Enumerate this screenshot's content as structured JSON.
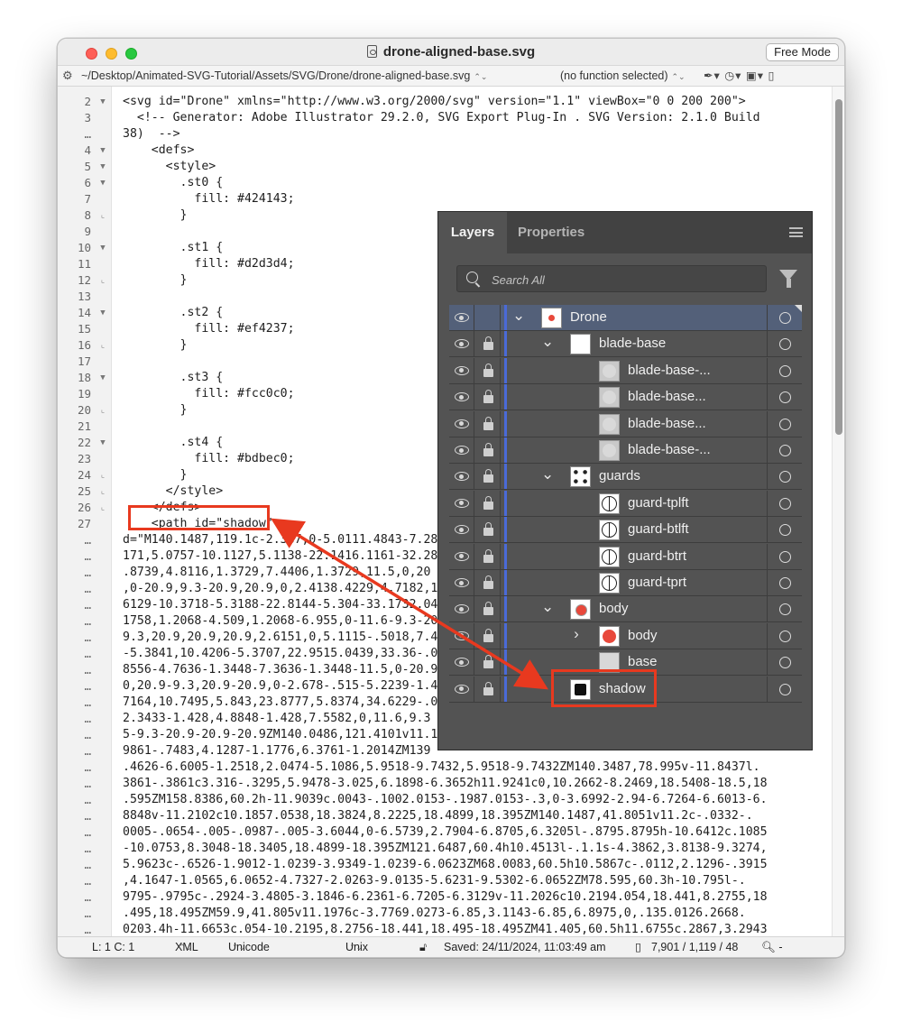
{
  "window": {
    "title": "drone-aligned-base.svg",
    "free_mode_button": "Free Mode"
  },
  "pathbar": {
    "path": "~/Desktop/Animated-SVG-Tutorial/Assets/SVG/Drone/drone-aligned-base.svg",
    "function_select": "(no function selected)"
  },
  "code": [
    {
      "ln": "2",
      "fold": "open",
      "cls": "tag",
      "text": "<svg id=\"Drone\" xmlns=\"http://www.w3.org/2000/svg\" version=\"1.1\" viewBox=\"0 0 200 200\">"
    },
    {
      "ln": "3",
      "fold": "",
      "cls": "cmt",
      "text": "  <!-- Generator: Adobe Illustrator 29.2.0, SVG Export Plug-In . SVG Version: 2.1.0 Build"
    },
    {
      "ln": "…",
      "fold": "",
      "cls": "cmt",
      "text": "38)  -->"
    },
    {
      "ln": "4",
      "fold": "open",
      "cls": "tag",
      "text": "    <defs>"
    },
    {
      "ln": "5",
      "fold": "open",
      "cls": "tag",
      "text": "      <style>"
    },
    {
      "ln": "6",
      "fold": "open",
      "cls": "",
      "text": "        .st0 {"
    },
    {
      "ln": "7",
      "fold": "",
      "cls": "",
      "text": "          fill: #424143;"
    },
    {
      "ln": "8",
      "fold": "close",
      "cls": "",
      "text": "        }"
    },
    {
      "ln": "9",
      "fold": "",
      "cls": "",
      "text": ""
    },
    {
      "ln": "10",
      "fold": "open",
      "cls": "",
      "text": "        .st1 {"
    },
    {
      "ln": "11",
      "fold": "",
      "cls": "",
      "text": "          fill: #d2d3d4;"
    },
    {
      "ln": "12",
      "fold": "close",
      "cls": "",
      "text": "        }"
    },
    {
      "ln": "13",
      "fold": "",
      "cls": "",
      "text": ""
    },
    {
      "ln": "14",
      "fold": "open",
      "cls": "",
      "text": "        .st2 {"
    },
    {
      "ln": "15",
      "fold": "",
      "cls": "",
      "text": "          fill: #ef4237;"
    },
    {
      "ln": "16",
      "fold": "close",
      "cls": "",
      "text": "        }"
    },
    {
      "ln": "17",
      "fold": "",
      "cls": "",
      "text": ""
    },
    {
      "ln": "18",
      "fold": "open",
      "cls": "",
      "text": "        .st3 {"
    },
    {
      "ln": "19",
      "fold": "",
      "cls": "",
      "text": "          fill: #fcc0c0;"
    },
    {
      "ln": "20",
      "fold": "close",
      "cls": "",
      "text": "        }"
    },
    {
      "ln": "21",
      "fold": "",
      "cls": "",
      "text": ""
    },
    {
      "ln": "22",
      "fold": "open",
      "cls": "",
      "text": "        .st4 {"
    },
    {
      "ln": "23",
      "fold": "",
      "cls": "",
      "text": "          fill: #bdbec0;"
    },
    {
      "ln": "24",
      "fold": "close",
      "cls": "",
      "text": "        }"
    },
    {
      "ln": "25",
      "fold": "close",
      "cls": "tag",
      "text": "      </style>"
    },
    {
      "ln": "26",
      "fold": "close",
      "cls": "tag",
      "text": "    </defs>"
    },
    {
      "ln": "27",
      "fold": "",
      "cls": "tag",
      "text": "    <path id=\"shadow\""
    },
    {
      "ln": "…",
      "fold": "",
      "cls": "dat",
      "text": "d=\"M140.1487,119.1c-2.387,0-5.0111.4843-7.2855,"
    },
    {
      "ln": "…",
      "fold": "",
      "cls": "dat",
      "text": "171,5.0757-10.1127,5.1138-22.1416.1161-32.28"
    },
    {
      "ln": "…",
      "fold": "",
      "cls": "dat",
      "text": ".8739,4.8116,1.3729,7.4406,1.3729,11.5,0,20"
    },
    {
      "ln": "…",
      "fold": "",
      "cls": "dat",
      "text": ",0-20.9,9.3-20.9,20.9,0,2.4138.4229,4.7182,1"
    },
    {
      "ln": "…",
      "fold": "",
      "cls": "dat",
      "text": "6129-10.3718-5.3188-22.8144-5.304-33.1732.04"
    },
    {
      "ln": "…",
      "fold": "",
      "cls": "dat",
      "text": "1758,1.2068-4.509,1.2068-6.955,0-11.6-9.3-20"
    },
    {
      "ln": "…",
      "fold": "",
      "cls": "dat",
      "text": "9.3,20.9,20.9,20.9,2.6151,0,5.1115-.5018,7.4"
    },
    {
      "ln": "…",
      "fold": "",
      "cls": "dat",
      "text": "-5.3841,10.4206-5.3707,22.9515.0439,33.36-.0"
    },
    {
      "ln": "…",
      "fold": "",
      "cls": "dat",
      "text": "8556-4.7636-1.3448-7.3636-1.3448-11.5,0-20.9"
    },
    {
      "ln": "…",
      "fold": "",
      "cls": "dat",
      "text": "0,20.9-9.3,20.9-20.9,0-2.678-.515-5.2239-1.4"
    },
    {
      "ln": "…",
      "fold": "",
      "cls": "dat",
      "text": "7164,10.7495,5.843,23.8777,5.8374,34.6229-.0"
    },
    {
      "ln": "…",
      "fold": "",
      "cls": "dat",
      "text": "2.3433-1.428,4.8848-1.428,7.5582,0,11.6,9.3"
    },
    {
      "ln": "…",
      "fold": "",
      "cls": "dat",
      "text": "5-9.3-20.9-20.9-20.9ZM140.0486,121.4101v11.1"
    },
    {
      "ln": "…",
      "fold": "",
      "cls": "dat",
      "text": "9861-.7483,4.1287-1.1776,6.3761-1.2014ZM139"
    },
    {
      "ln": "…",
      "fold": "",
      "cls": "dat",
      "text": ".4626-6.6005-1.2518,2.0474-5.1086,5.9518-9.7432,5.9518-9.7432ZM140.3487,78.995v-11.8437l."
    },
    {
      "ln": "…",
      "fold": "",
      "cls": "dat",
      "text": "3861-.3861c3.316-.3295,5.9478-3.025,6.1898-6.3652h11.9241c0,10.2662-8.2469,18.5408-18.5,18"
    },
    {
      "ln": "…",
      "fold": "",
      "cls": "dat",
      "text": ".595ZM158.8386,60.2h-11.9039c.0043-.1002.0153-.1987.0153-.3,0-3.6992-2.94-6.7264-6.6013-6."
    },
    {
      "ln": "…",
      "fold": "",
      "cls": "dat",
      "text": "8848v-11.2102c10.1857.0538,18.3824,8.2225,18.4899,18.395ZM140.1487,41.8051v11.2c-.0332-."
    },
    {
      "ln": "…",
      "fold": "",
      "cls": "dat",
      "text": "0005-.0654-.005-.0987-.005-3.6044,0-6.5739,2.7904-6.8705,6.3205l-.8795.8795h-10.6412c.1085"
    },
    {
      "ln": "…",
      "fold": "",
      "cls": "dat",
      "text": "-10.0753,8.3048-18.3405,18.4899-18.395ZM121.6487,60.4h10.4513l-.1.1s-4.3862,3.8138-9.3274,"
    },
    {
      "ln": "…",
      "fold": "",
      "cls": "dat",
      "text": "5.9623c-.6526-1.9012-1.0239-3.9349-1.0239-6.0623ZM68.0083,60.5h10.5867c-.0112,2.1296-.3915"
    },
    {
      "ln": "…",
      "fold": "",
      "cls": "dat",
      "text": ",4.1647-1.0565,6.0652-4.7327-2.0263-9.0135-5.6231-9.5302-6.0652ZM78.595,60.3h-10.795l-."
    },
    {
      "ln": "…",
      "fold": "",
      "cls": "dat",
      "text": "9795-.9795c-.2924-3.4805-3.1846-6.2361-6.7205-6.3129v-11.2026c10.2194.054,18.441,8.2755,18"
    },
    {
      "ln": "…",
      "fold": "",
      "cls": "dat",
      "text": ".495,18.495ZM59.9,41.805v11.1976c-3.7769.0273-6.85,3.1143-6.85,6.8975,0,.135.0126.2668."
    },
    {
      "ln": "…",
      "fold": "",
      "cls": "dat",
      "text": "0203.4h-11.6653c.054-10.2195,8.2756-18.441,18.495-18.495ZM41.405,60.5h11.6755c.2867,3.2943"
    }
  ],
  "layers_panel": {
    "tab_layers": "Layers",
    "tab_properties": "Properties",
    "search_placeholder": "Search All",
    "rows": [
      {
        "name": "Drone",
        "indent": 0,
        "chevron": "down",
        "thumb": "drone-t",
        "lock": false,
        "selected": true
      },
      {
        "name": "blade-base",
        "indent": 1,
        "chevron": "down",
        "thumb": "plain",
        "lock": true,
        "selected": false
      },
      {
        "name": "blade-base-...",
        "indent": 2,
        "chevron": "",
        "thumb": "grey",
        "lock": true,
        "selected": false
      },
      {
        "name": "blade-base...",
        "indent": 2,
        "chevron": "",
        "thumb": "grey",
        "lock": true,
        "selected": false
      },
      {
        "name": "blade-base...",
        "indent": 2,
        "chevron": "",
        "thumb": "grey",
        "lock": true,
        "selected": false
      },
      {
        "name": "blade-base-...",
        "indent": 2,
        "chevron": "",
        "thumb": "grey",
        "lock": true,
        "selected": false
      },
      {
        "name": "guards",
        "indent": 1,
        "chevron": "down",
        "thumb": "guards-t",
        "lock": true,
        "selected": false
      },
      {
        "name": "guard-tplft",
        "indent": 2,
        "chevron": "",
        "thumb": "guard",
        "lock": true,
        "selected": false
      },
      {
        "name": "guard-btlft",
        "indent": 2,
        "chevron": "",
        "thumb": "guard",
        "lock": true,
        "selected": false
      },
      {
        "name": "guard-btrt",
        "indent": 2,
        "chevron": "",
        "thumb": "guard",
        "lock": true,
        "selected": false
      },
      {
        "name": "guard-tprt",
        "indent": 2,
        "chevron": "",
        "thumb": "guard",
        "lock": true,
        "selected": false
      },
      {
        "name": "body",
        "indent": 1,
        "chevron": "down",
        "thumb": "body-t",
        "lock": true,
        "selected": false
      },
      {
        "name": "body",
        "indent": 2,
        "chevron": "right",
        "thumb": "red-dot",
        "lock": true,
        "selected": false
      },
      {
        "name": "base",
        "indent": 2,
        "chevron": "",
        "thumb": "base-t",
        "lock": true,
        "selected": false
      },
      {
        "name": "shadow",
        "indent": 1,
        "chevron": "",
        "thumb": "shadow-t",
        "lock": true,
        "selected": false
      }
    ]
  },
  "statusbar": {
    "position": "L: 1 C: 1",
    "language": "XML",
    "encoding": "Unicode (UTF-8)",
    "line_endings": "Unix (LF)",
    "saved": "Saved: 24/11/2024, 11:03:49 am",
    "counts": "7,901 / 1,119 / 48"
  },
  "colors": {
    "callout": "#e8391f",
    "tag": "#2f3bd8",
    "path_data": "#b0124a",
    "panel_bg": "#535353",
    "selected_row": "#536079"
  }
}
